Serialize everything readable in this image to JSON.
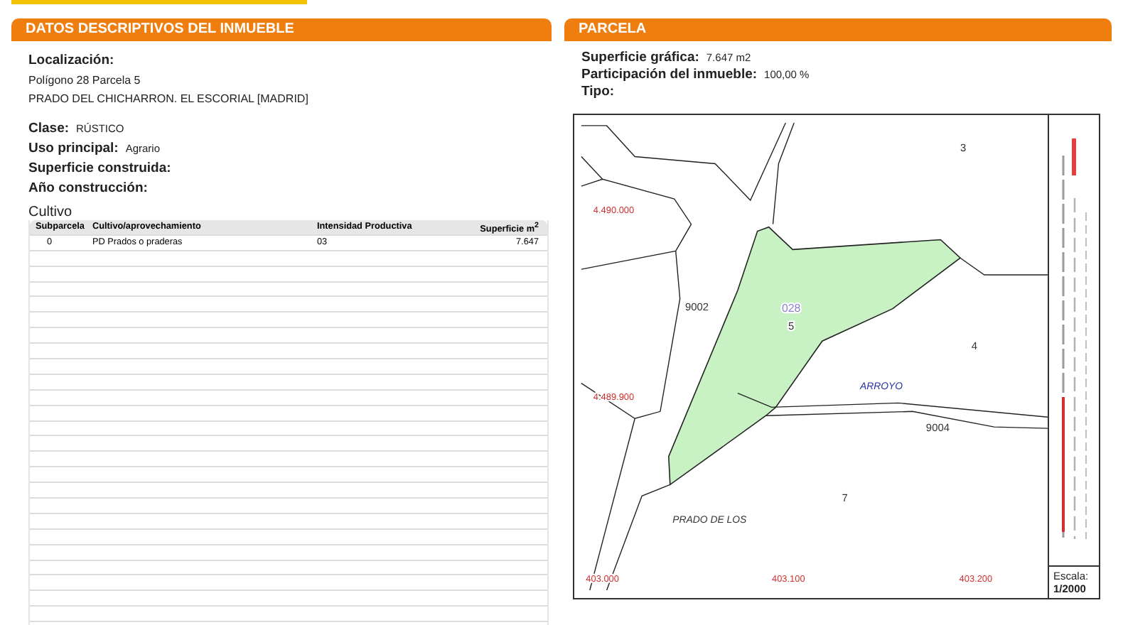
{
  "left_panel": {
    "title": "DATOS DESCRIPTIVOS DEL INMUEBLE",
    "location_label": "Localización:",
    "location_lines": [
      "Polígono 28 Parcela 5",
      "PRADO DEL CHICHARRON. EL ESCORIAL [MADRID]"
    ],
    "fields": [
      {
        "label": "Clase:",
        "value": "RÚSTICO"
      },
      {
        "label": "Uso principal:",
        "value": "Agrario"
      },
      {
        "label": "Superficie construida:"
      },
      {
        "label": "Año construcción:"
      }
    ],
    "cultivo": {
      "title": "Cultivo",
      "columns": [
        "Subparcela",
        "Cultivo/aprovechamiento",
        "Intensidad Productiva",
        "Superficie m$^{2}$"
      ],
      "rows": [
        [
          "0",
          "PD Prados o praderas",
          "03",
          "7.647"
        ]
      ]
    }
  },
  "right_panel": {
    "title": "PARCELA",
    "fields": [
      {
        "label": "Superficie gráfica:",
        "value": "7.647 m2"
      },
      {
        "label": "Participación del inmueble:",
        "value": "100,00 %"
      },
      {
        "label": "Tipo:"
      }
    ],
    "map": {
      "labels": [
        {
          "text": "028",
          "kind": "parcel-code"
        },
        {
          "text": "5",
          "kind": "parcel"
        },
        {
          "text": "9002",
          "kind": "parcel"
        },
        {
          "text": "3",
          "kind": "parcel"
        },
        {
          "text": "4",
          "kind": "parcel"
        },
        {
          "text": "ARROYO",
          "kind": "place"
        },
        {
          "text": "9004",
          "kind": "parcel"
        },
        {
          "text": "7",
          "kind": "parcel"
        },
        {
          "text": "PRADO DE LOS",
          "kind": "place"
        },
        {
          "text": "4.490.000",
          "kind": "coord"
        },
        {
          "text": "4.489.900",
          "kind": "coord"
        },
        {
          "text": "403.000",
          "kind": "coord"
        },
        {
          "text": "403.100",
          "kind": "coord"
        },
        {
          "text": "403.200",
          "kind": "coord"
        }
      ],
      "scale_label": "Escala:",
      "scale_value": "1/2000"
    }
  }
}
